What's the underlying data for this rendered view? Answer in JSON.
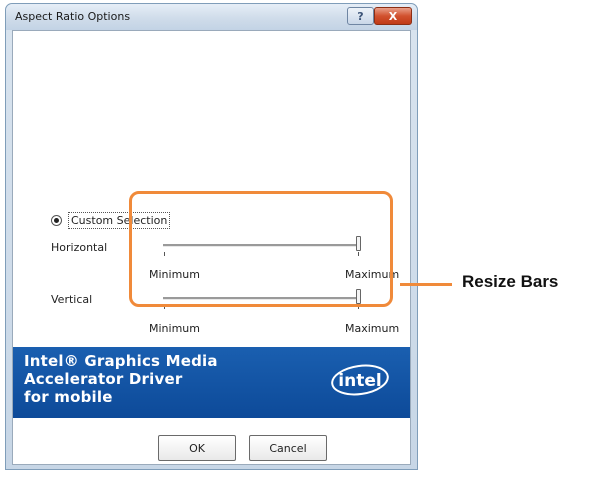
{
  "window": {
    "title": "Aspect Ratio Options"
  },
  "titlebar_buttons": {
    "help": "?",
    "close": "X"
  },
  "custom_selection": {
    "label": "Custom Selection",
    "selected": true
  },
  "horizontal": {
    "label": "Horizontal",
    "min_label": "Minimum",
    "max_label": "Maximum",
    "value": 1.0
  },
  "vertical": {
    "label": "Vertical",
    "min_label": "Minimum",
    "max_label": "Maximum",
    "value": 1.0
  },
  "banner": {
    "line1": "Intel® Graphics Media",
    "line2": "Accelerator Driver",
    "line3": "for mobile",
    "logo_text": "intel",
    "background": "#0f4f9e"
  },
  "buttons": {
    "ok": "OK",
    "cancel": "Cancel"
  },
  "callout": {
    "text": "Resize Bars",
    "color": "#f08a3a"
  }
}
